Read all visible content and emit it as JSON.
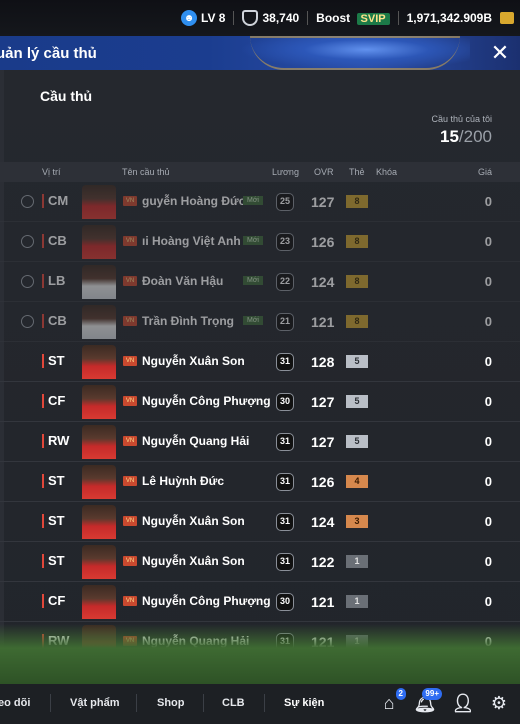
{
  "topbar": {
    "level": "LV 8",
    "shield_value": "38,740",
    "boost_label": "Boost",
    "svip_label": "SVIP",
    "coins": "1,971,342.909B"
  },
  "header": {
    "title": "uản lý cầu thủ",
    "close_label": "✕"
  },
  "panel": {
    "section_title": "Cầu thủ",
    "my_players_label": "Cầu thủ của tôi",
    "my_players_count": "15",
    "my_players_max": "/200"
  },
  "table": {
    "headers": {
      "position": "Vị trí",
      "name": "Tên cầu thủ",
      "salary": "Lương",
      "ovr": "OVR",
      "card": "Thẻ",
      "lock": "Khóa",
      "price": "Giá"
    },
    "rows": [
      {
        "locked": true,
        "position": "CM",
        "name": "guyễn Hoàng Đức",
        "new": "Mới",
        "salary": "25",
        "ovr": "127",
        "card": "8",
        "card_tier": "gold",
        "price": "0",
        "kit": "red"
      },
      {
        "locked": true,
        "position": "CB",
        "name": "ıi Hoàng Việt Anh",
        "new": "Mới",
        "salary": "23",
        "ovr": "126",
        "card": "8",
        "card_tier": "gold",
        "price": "0",
        "kit": "red"
      },
      {
        "locked": true,
        "position": "LB",
        "name": "Đoàn Văn Hậu",
        "new": "Mới",
        "salary": "22",
        "ovr": "124",
        "card": "8",
        "card_tier": "gold",
        "price": "0",
        "kit": "white"
      },
      {
        "locked": true,
        "position": "CB",
        "name": "Trần Đình Trọng",
        "new": "Mới",
        "salary": "21",
        "ovr": "121",
        "card": "8",
        "card_tier": "gold",
        "price": "0",
        "kit": "white"
      },
      {
        "locked": false,
        "position": "ST",
        "name": "Nguyễn Xuân Son",
        "new": "",
        "salary": "31",
        "ovr": "128",
        "card": "5",
        "card_tier": "silver",
        "price": "0",
        "kit": "red"
      },
      {
        "locked": false,
        "position": "CF",
        "name": "Nguyễn Công Phượng",
        "new": "",
        "salary": "30",
        "ovr": "127",
        "card": "5",
        "card_tier": "silver",
        "price": "0",
        "kit": "red"
      },
      {
        "locked": false,
        "position": "RW",
        "name": "Nguyễn Quang Hải",
        "new": "",
        "salary": "31",
        "ovr": "127",
        "card": "5",
        "card_tier": "silver",
        "price": "0",
        "kit": "red"
      },
      {
        "locked": false,
        "position": "ST",
        "name": "Lê Huỳnh Đức",
        "new": "",
        "salary": "31",
        "ovr": "126",
        "card": "4",
        "card_tier": "bronze",
        "price": "0",
        "kit": "red"
      },
      {
        "locked": false,
        "position": "ST",
        "name": "Nguyễn Xuân Son",
        "new": "",
        "salary": "31",
        "ovr": "124",
        "card": "3",
        "card_tier": "bronze",
        "price": "0",
        "kit": "red"
      },
      {
        "locked": false,
        "position": "ST",
        "name": "Nguyễn Xuân Son",
        "new": "",
        "salary": "31",
        "ovr": "122",
        "card": "1",
        "card_tier": "grey",
        "price": "0",
        "kit": "red"
      },
      {
        "locked": false,
        "position": "CF",
        "name": "Nguyễn Công Phượng",
        "new": "",
        "salary": "30",
        "ovr": "121",
        "card": "1",
        "card_tier": "grey",
        "price": "0",
        "kit": "red"
      },
      {
        "locked": false,
        "position": "RW",
        "name": "Nguyễn Quang Hải",
        "new": "",
        "salary": "31",
        "ovr": "121",
        "card": "1",
        "card_tier": "grey",
        "price": "0",
        "kit": "red"
      }
    ]
  },
  "bottom_nav": {
    "tabs": [
      "eo dõi",
      "Vật phẩm",
      "Shop",
      "CLB",
      "Sự kiện"
    ],
    "home_badge": "2",
    "notify_badge": "99+"
  },
  "colors": {
    "accent_red": "#e2473a",
    "header_blue": "#1b3d8f",
    "card_gold": "#c8a030",
    "card_silver": "#b9bec6",
    "card_bronze": "#d6884d",
    "badge_blue": "#2f6df2"
  },
  "icons": {
    "level": "user-level-icon",
    "shield": "shield-icon",
    "coin": "coin-icon",
    "close": "close-icon",
    "lock": "lock-icon",
    "home": "home-icon",
    "bell": "bell-icon",
    "profile": "profile-icon",
    "settings": "gear-icon"
  }
}
